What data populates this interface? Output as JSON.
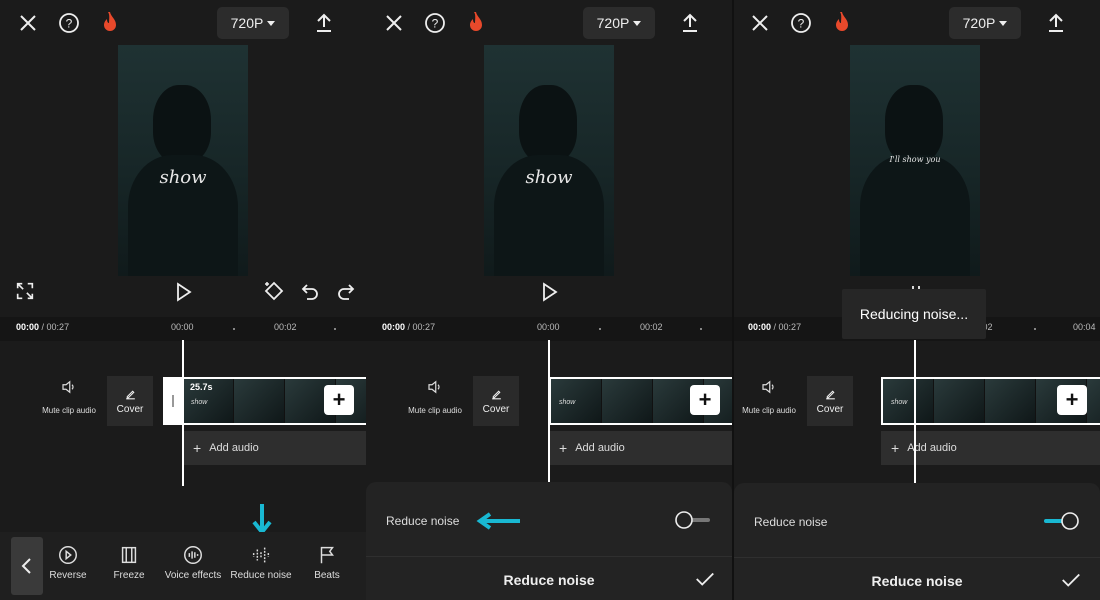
{
  "panels": [
    {
      "resolution": "720P",
      "time_current": "00:00",
      "time_total": "/ 00:27",
      "ruler_marks": [
        "00:00",
        "00:02"
      ],
      "mute_label": "Mute clip audio",
      "cover_label": "Cover",
      "clip_duration": "25.7s",
      "add_audio_label": "Add audio",
      "toolbar": {
        "items": [
          {
            "label": "Reverse",
            "icon": "reverse-icon"
          },
          {
            "label": "Freeze",
            "icon": "freeze-icon"
          },
          {
            "label": "Voice effects",
            "icon": "voice-effects-icon"
          },
          {
            "label": "Reduce noise",
            "icon": "reduce-noise-icon"
          },
          {
            "label": "Beats",
            "icon": "beats-icon"
          }
        ]
      }
    },
    {
      "resolution": "720P",
      "time_current": "00:00",
      "time_total": "/ 00:27",
      "ruler_marks": [
        "00:00",
        "00:02"
      ],
      "mute_label": "Mute clip audio",
      "cover_label": "Cover",
      "add_audio_label": "Add audio",
      "sheet": {
        "row_label": "Reduce noise",
        "toggle_on": false,
        "title": "Reduce noise"
      }
    },
    {
      "resolution": "720P",
      "time_current": "00:00",
      "time_total": "/ 00:27",
      "ruler_marks": [
        "00:02",
        "00:04"
      ],
      "mute_label": "Mute clip audio",
      "cover_label": "Cover",
      "add_audio_label": "Add audio",
      "toast": "Reducing noise...",
      "sheet": {
        "row_label": "Reduce noise",
        "toggle_on": true,
        "title": "Reduce noise"
      }
    }
  ],
  "preview_text": {
    "main": "show",
    "sub": "I'll show you"
  },
  "colors": {
    "accent": "#19b8d2",
    "flame": "#e8492b",
    "background": "#1b1b1b"
  }
}
